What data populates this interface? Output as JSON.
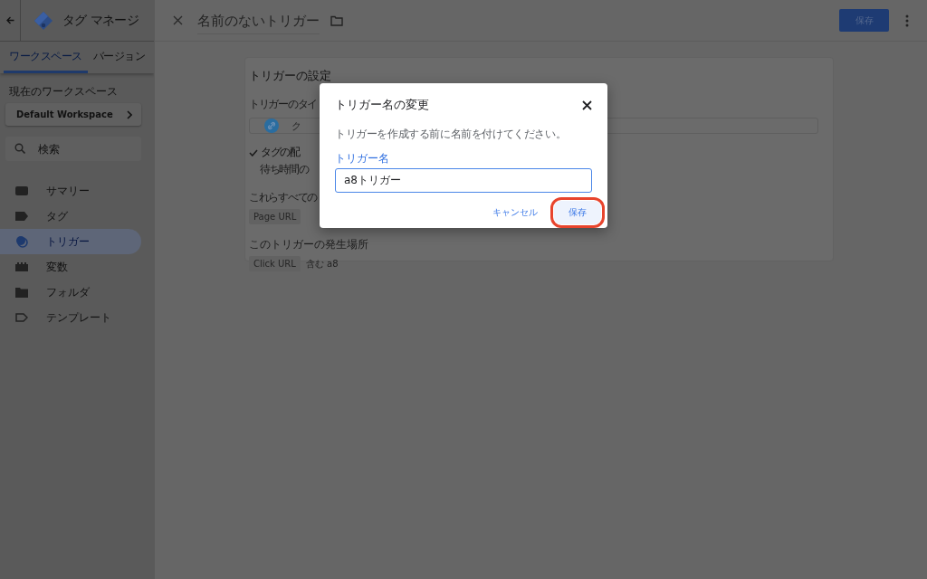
{
  "sidebar": {
    "title": "タグ マネージ",
    "tabs": [
      {
        "label": "ワークスペース",
        "selected": true
      },
      {
        "label": "バージョン",
        "selected": false
      }
    ],
    "workspace_label": "現在のワークスペース",
    "workspace": "Default Workspace",
    "search": {
      "placeholder": "検索"
    },
    "nav": [
      {
        "label": "サマリー",
        "selected": false
      },
      {
        "label": "タグ",
        "selected": false
      },
      {
        "label": "トリガー",
        "selected": true
      },
      {
        "label": "変数",
        "selected": false
      },
      {
        "label": "フォルダ",
        "selected": false
      },
      {
        "label": "テンプレート",
        "selected": false
      }
    ]
  },
  "editor": {
    "title": "名前のないトリガー",
    "save": "保存",
    "card": {
      "heading": "トリガーの設定",
      "type_label": "トリガーのタイ",
      "type_value": "ク",
      "fire_option": "タグの配",
      "fire_note": "待ち時間の",
      "conditions_label": "これらすべての",
      "condition_chip": "Page URL",
      "where_label": "このトリガーの発生場所",
      "where_chip": "Click URL",
      "where_value": "含む a8"
    }
  },
  "dialog": {
    "title": "トリガー名の変更",
    "description": "トリガーを作成する前に名前を付けてください。",
    "field": {
      "label": "トリガー名",
      "value": "a8トリガー"
    },
    "buttons": [
      {
        "label": "キャンセル",
        "kind": "text",
        "highlighted": false
      },
      {
        "label": "保存",
        "kind": "tonal",
        "highlighted": true
      }
    ]
  }
}
